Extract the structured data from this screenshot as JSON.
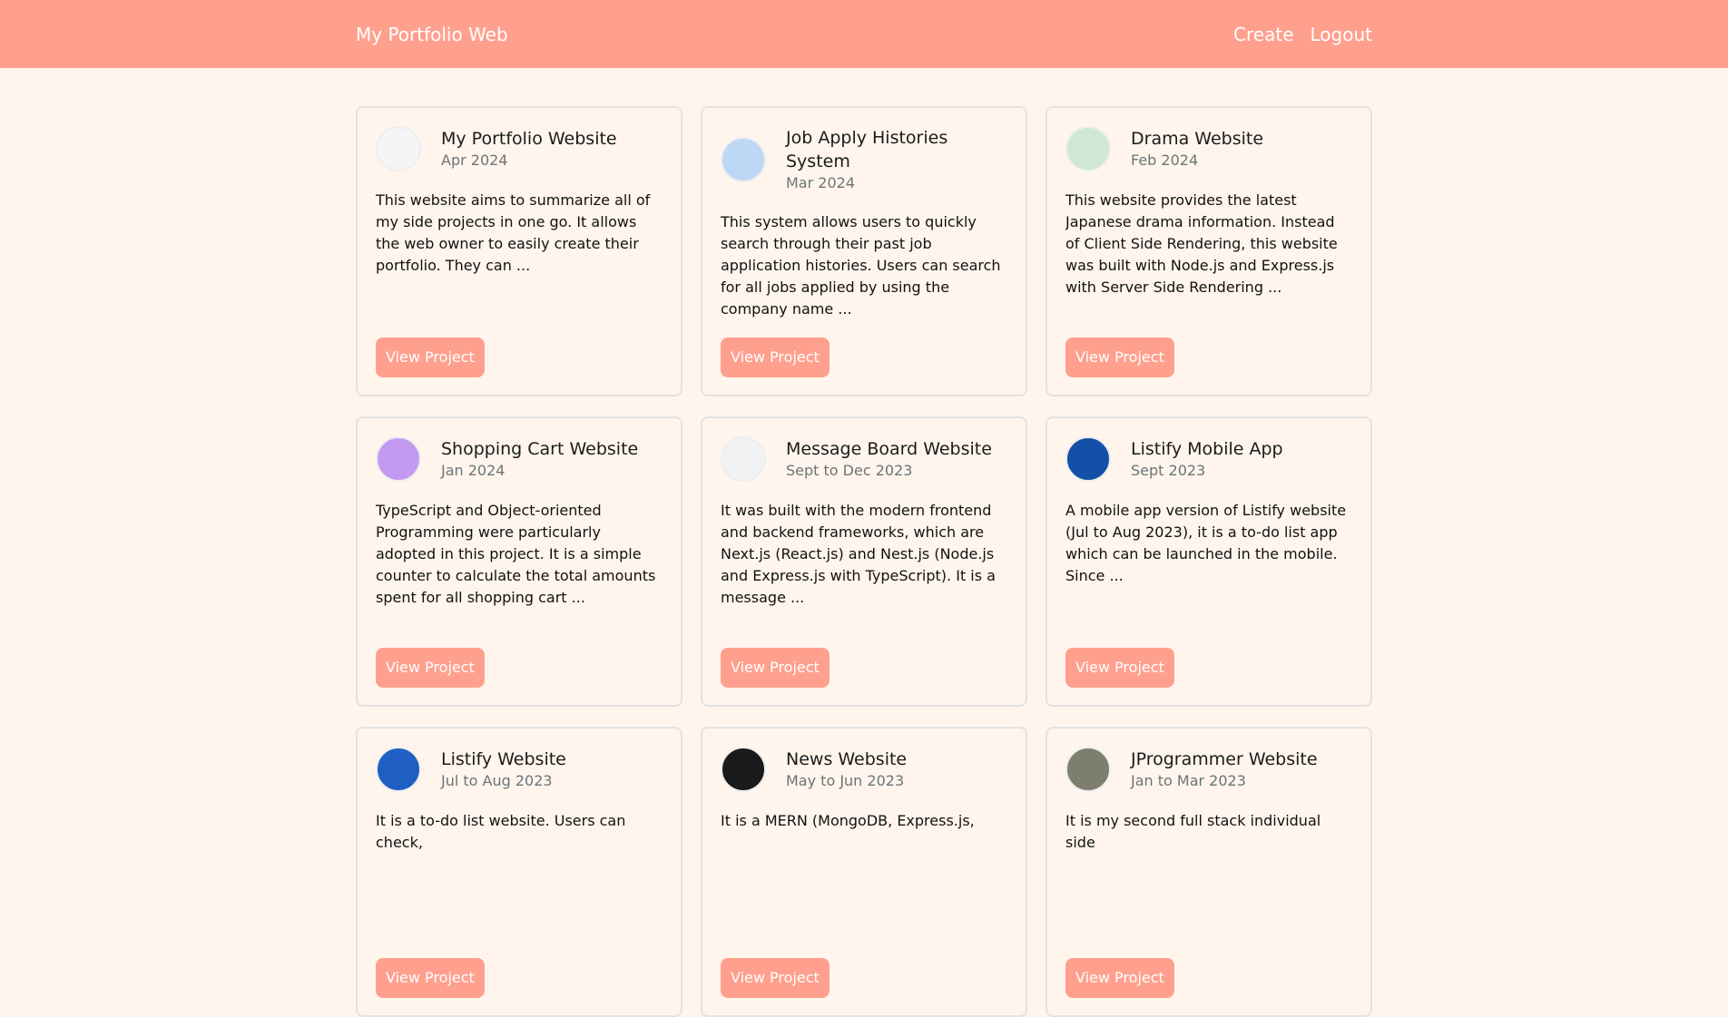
{
  "nav": {
    "brand": "My Portfolio Web",
    "links": [
      "Create",
      "Logout"
    ]
  },
  "colors": {
    "accent": "#ffa08e",
    "background": "#fff5ec",
    "card_border": "#e4e2e4"
  },
  "projects": [
    {
      "title": "My Portfolio Website",
      "date": "Apr 2024",
      "description": "This website aims to summarize all of my side projects in one go. It allows the web owner to easily create their portfolio. They can ...",
      "button": "View Project",
      "thumb_icon": "grid-icon",
      "thumb_color": "#f5f5f7"
    },
    {
      "title": "Job Apply Histories System",
      "date": "Mar 2024",
      "description": "This system allows users to quickly search through their past job application histories. Users can search for all jobs applied by using the company name ...",
      "button": "View Project",
      "thumb_icon": "list-icon",
      "thumb_color": "#bcd8f5"
    },
    {
      "title": "Drama Website",
      "date": "Feb 2024",
      "description": "This website provides the latest Japanese drama information. Instead of Client Side Rendering, this website was built with Node.js and Express.js with Server Side Rendering ...",
      "button": "View Project",
      "thumb_icon": "person-icon",
      "thumb_color": "#cfe8d4"
    },
    {
      "title": "Shopping Cart Website",
      "date": "Jan 2024",
      "description": "TypeScript and Object-oriented Programming were particularly adopted in this project. It is a simple counter to calculate the total amounts spent for all shopping cart ...",
      "button": "View Project",
      "thumb_icon": "cart-icon",
      "thumb_color": "#c39af0"
    },
    {
      "title": "Message Board Website",
      "date": "Sept to Dec 2023",
      "description": "It was built with the modern frontend and backend frameworks, which are Next.js (React.js) and Nest.js (Node.js and Express.js with TypeScript). It is a message ...",
      "button": "View Project",
      "thumb_icon": "message-icon",
      "thumb_color": "#f1f2f4"
    },
    {
      "title": "Listify Mobile App",
      "date": "Sept 2023",
      "description": "A mobile app version of Listify website (Jul to Aug 2023), it is a to-do list app which can be launched in the mobile. Since ...",
      "button": "View Project",
      "thumb_icon": "phone-icon",
      "thumb_color": "#1550a8"
    },
    {
      "title": "Listify Website",
      "date": "Jul to Aug 2023",
      "description": "It is a to-do list website. Users can check,",
      "button": "View Project",
      "thumb_icon": "list-icon",
      "thumb_color": "#1f5fc4"
    },
    {
      "title": "News Website",
      "date": "May to Jun 2023",
      "description": "It is a MERN (MongoDB, Express.js,",
      "button": "View Project",
      "thumb_icon": "news-icon",
      "thumb_color": "#1a1a1a"
    },
    {
      "title": "JProgrammer Website",
      "date": "Jan to Mar 2023",
      "description": "It is my second full stack individual side",
      "button": "View Project",
      "thumb_icon": "photo-icon",
      "thumb_color": "#7d7f6c"
    }
  ]
}
